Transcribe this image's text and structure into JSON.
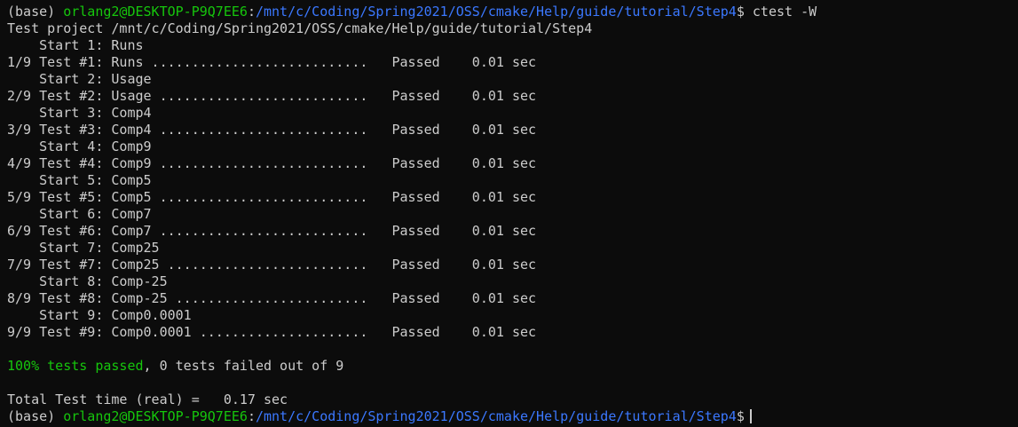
{
  "prompt1": {
    "env": "(base) ",
    "user_host": "orlang2@DESKTOP-P9Q7EE6",
    "colon": ":",
    "path": "/mnt/c/Coding/Spring2021/OSS/cmake/Help/guide/tutorial/Step4",
    "dollar": "$",
    "command": " ctest -W"
  },
  "project_line": "Test project /mnt/c/Coding/Spring2021/OSS/cmake/Help/guide/tutorial/Step4",
  "tests": [
    {
      "start": "    Start 1: Runs",
      "result": "1/9 Test #1: Runs ...........................   Passed    0.01 sec"
    },
    {
      "start": "    Start 2: Usage",
      "result": "2/9 Test #2: Usage ..........................   Passed    0.01 sec"
    },
    {
      "start": "    Start 3: Comp4",
      "result": "3/9 Test #3: Comp4 ..........................   Passed    0.01 sec"
    },
    {
      "start": "    Start 4: Comp9",
      "result": "4/9 Test #4: Comp9 ..........................   Passed    0.01 sec"
    },
    {
      "start": "    Start 5: Comp5",
      "result": "5/9 Test #5: Comp5 ..........................   Passed    0.01 sec"
    },
    {
      "start": "    Start 6: Comp7",
      "result": "6/9 Test #6: Comp7 ..........................   Passed    0.01 sec"
    },
    {
      "start": "    Start 7: Comp25",
      "result": "7/9 Test #7: Comp25 .........................   Passed    0.01 sec"
    },
    {
      "start": "    Start 8: Comp-25",
      "result": "8/9 Test #8: Comp-25 ........................   Passed    0.01 sec"
    },
    {
      "start": "    Start 9: Comp0.0001",
      "result": "9/9 Test #9: Comp0.0001 .....................   Passed    0.01 sec"
    }
  ],
  "summary": {
    "passed_text": "100% tests passed",
    "rest_text": ", 0 tests failed out of 9"
  },
  "total_time": "Total Test time (real) =   0.17 sec",
  "prompt2": {
    "env": "(base) ",
    "user_host": "orlang2@DESKTOP-P9Q7EE6",
    "colon": ":",
    "path": "/mnt/c/Coding/Spring2021/OSS/cmake/Help/guide/tutorial/Step4",
    "dollar": "$"
  },
  "colors": {
    "background": "#0c0c0c",
    "foreground": "#cccccc",
    "green": "#16c60c",
    "blue": "#3b78ff"
  }
}
